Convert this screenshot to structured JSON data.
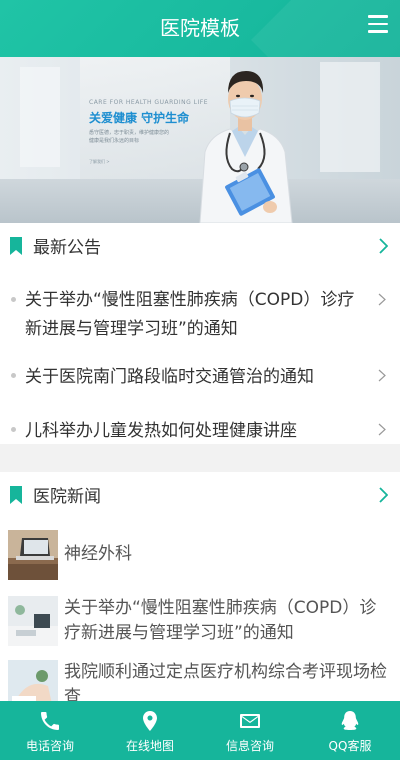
{
  "header": {
    "title": "医院模板"
  },
  "banner": {
    "small_text": "CARE FOR HEALTH GUARDING LIFE",
    "slogan": "关爱健康  守护生命",
    "description": "悉守医德，忠于职责，维护健康您的健康是我们永远的目标",
    "more": "了解我们 >"
  },
  "notices": {
    "title": "最新公告",
    "items": [
      {
        "text": "关于举办“慢性阻塞性肺疾病（COPD）诊疗新进展与管理学习班”的通知"
      },
      {
        "text": "关于医院南门路段临时交通管治的通知"
      },
      {
        "text": "儿科举办儿童发热如何处理健康讲座"
      }
    ]
  },
  "news": {
    "title": "医院新闻",
    "items": [
      {
        "text": "神经外科"
      },
      {
        "text": "关于举办“慢性阻塞性肺疾病（COPD）诊疗新进展与管理学习班”的通知"
      },
      {
        "text": "我院顺利通过定点医疗机构综合考评现场检查"
      }
    ]
  },
  "bottom_nav": {
    "items": [
      {
        "label": "电话咨询",
        "icon": "phone-icon"
      },
      {
        "label": "在线地图",
        "icon": "map-pin-icon"
      },
      {
        "label": "信息咨询",
        "icon": "mail-icon"
      },
      {
        "label": "QQ客服",
        "icon": "qq-icon"
      }
    ]
  },
  "colors": {
    "accent": "#16b59b",
    "header": "#20c4a6",
    "text": "#333333",
    "slogan": "#1d8ed0"
  }
}
